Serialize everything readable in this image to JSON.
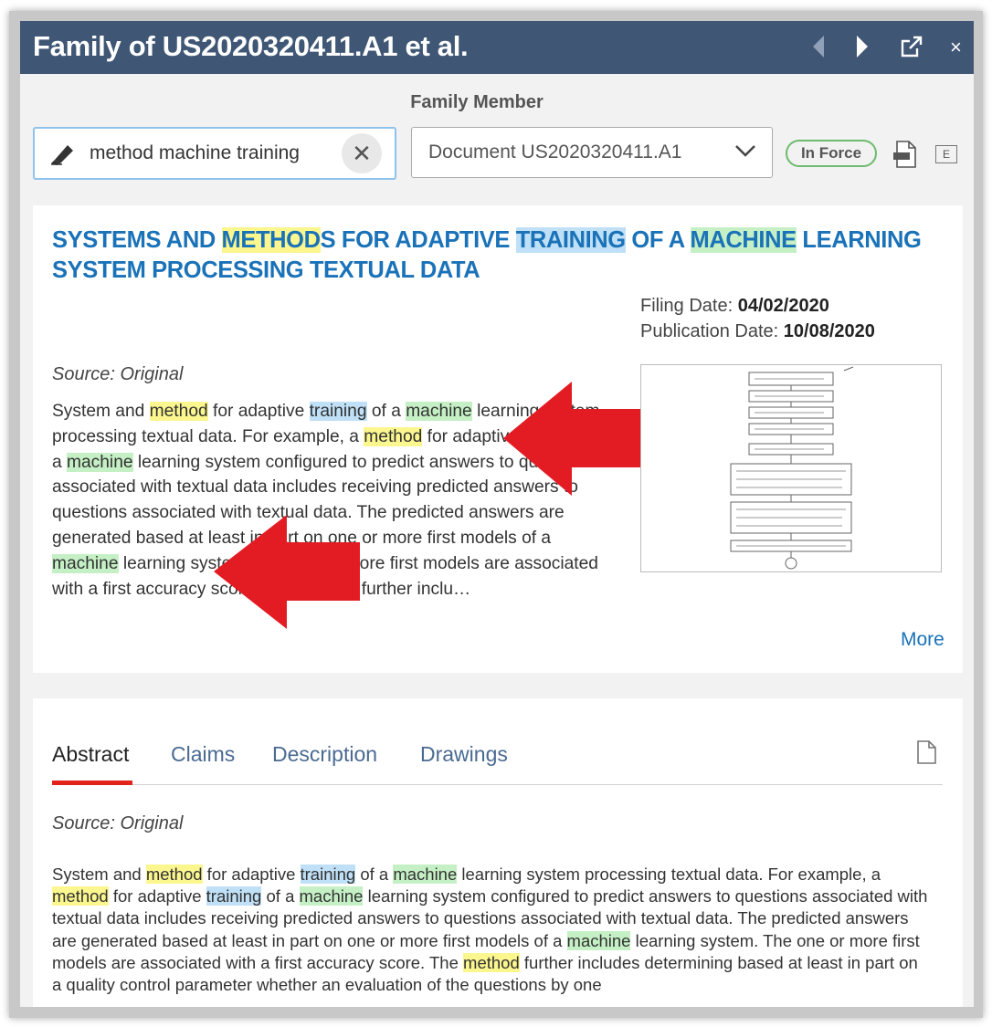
{
  "window": {
    "title": "Family of US2020320411.A1 et al.",
    "icons": [
      "chevron-left-icon",
      "chevron-right-icon",
      "open-external-icon",
      "close-icon"
    ],
    "close_glyph": "×"
  },
  "family_member_label": "Family Member",
  "search": {
    "value": "method machine training",
    "clear_glyph": "✕"
  },
  "document_select": {
    "value": "Document US2020320411.A1"
  },
  "status_badge": "In Force",
  "export_e_label": "E",
  "colors": {
    "titlebar": "#3f5675",
    "accent_link": "#1a72b8",
    "highlight_method": "#fbf68e",
    "highlight_training": "#bfe0f6",
    "highlight_machine": "#c5f0c5",
    "tab_underline": "#e2231a",
    "arrow": "#e31b23"
  },
  "doc": {
    "title_parts": [
      {
        "text": "SYSTEMS AND ",
        "hl": ""
      },
      {
        "text": "METHOD",
        "hl": "y"
      },
      {
        "text": "S FOR ADAPTIVE ",
        "hl": ""
      },
      {
        "text": "TRAINING",
        "hl": "b"
      },
      {
        "text": " OF A ",
        "hl": ""
      },
      {
        "text": "MACHINE",
        "hl": "g"
      },
      {
        "text": " LEARNING SYSTEM PROCESSING TEXTUAL DATA",
        "hl": ""
      }
    ],
    "filing_date_label": "Filing Date:",
    "filing_date": "04/02/2020",
    "publication_date_label": "Publication Date:",
    "publication_date": "10/08/2020",
    "source": "Source: Original",
    "summary_parts": [
      {
        "text": "System and ",
        "hl": ""
      },
      {
        "text": "method",
        "hl": "y"
      },
      {
        "text": " for adaptive ",
        "hl": ""
      },
      {
        "text": "training",
        "hl": "b"
      },
      {
        "text": " of a ",
        "hl": ""
      },
      {
        "text": "machine",
        "hl": "g"
      },
      {
        "text": " learning system processing textual data. For example, a ",
        "hl": ""
      },
      {
        "text": "method",
        "hl": "y"
      },
      {
        "text": " for adaptive ",
        "hl": ""
      },
      {
        "text": "training",
        "hl": "b"
      },
      {
        "text": " of a ",
        "hl": ""
      },
      {
        "text": "machine",
        "hl": "g"
      },
      {
        "text": " learning system configured to predict answers to questions associated with textual data includes receiving predicted answers to questions associated with textual data. The predicted answers are generated based at least in part on one or more first models of a ",
        "hl": ""
      },
      {
        "text": "machine",
        "hl": "g"
      },
      {
        "text": " learning system. The one or more first models are associated with a first accuracy score. The ",
        "hl": ""
      },
      {
        "text": "method",
        "hl": "y"
      },
      {
        "text": " further inclu…",
        "hl": ""
      }
    ],
    "more_link": "More"
  },
  "tabs": [
    {
      "label": "Abstract",
      "active": true
    },
    {
      "label": "Claims",
      "active": false
    },
    {
      "label": "Description",
      "active": false
    },
    {
      "label": "Drawings",
      "active": false
    }
  ],
  "abstract": {
    "source": "Source: Original",
    "parts": [
      {
        "text": "System and ",
        "hl": ""
      },
      {
        "text": "method",
        "hl": "y"
      },
      {
        "text": " for adaptive ",
        "hl": ""
      },
      {
        "text": "training",
        "hl": "b"
      },
      {
        "text": " of a ",
        "hl": ""
      },
      {
        "text": "machine",
        "hl": "g"
      },
      {
        "text": " learning system processing textual data. For example, a ",
        "hl": ""
      },
      {
        "text": "method",
        "hl": "y"
      },
      {
        "text": " for adaptive ",
        "hl": ""
      },
      {
        "text": "training",
        "hl": "b"
      },
      {
        "text": " of a ",
        "hl": ""
      },
      {
        "text": "machine",
        "hl": "g"
      },
      {
        "text": " learning system configured to predict answers to questions associated with textual data includes receiving predicted answers to questions associated with textual data. The predicted answers are generated based at least in part on one or more first models of a ",
        "hl": ""
      },
      {
        "text": "machine",
        "hl": "g"
      },
      {
        "text": " learning system. The one or more first models are associated with a first accuracy score. The ",
        "hl": ""
      },
      {
        "text": "method",
        "hl": "y"
      },
      {
        "text": " further includes determining based at least in part on a quality control parameter whether an evaluation of the questions by one",
        "hl": ""
      }
    ]
  }
}
